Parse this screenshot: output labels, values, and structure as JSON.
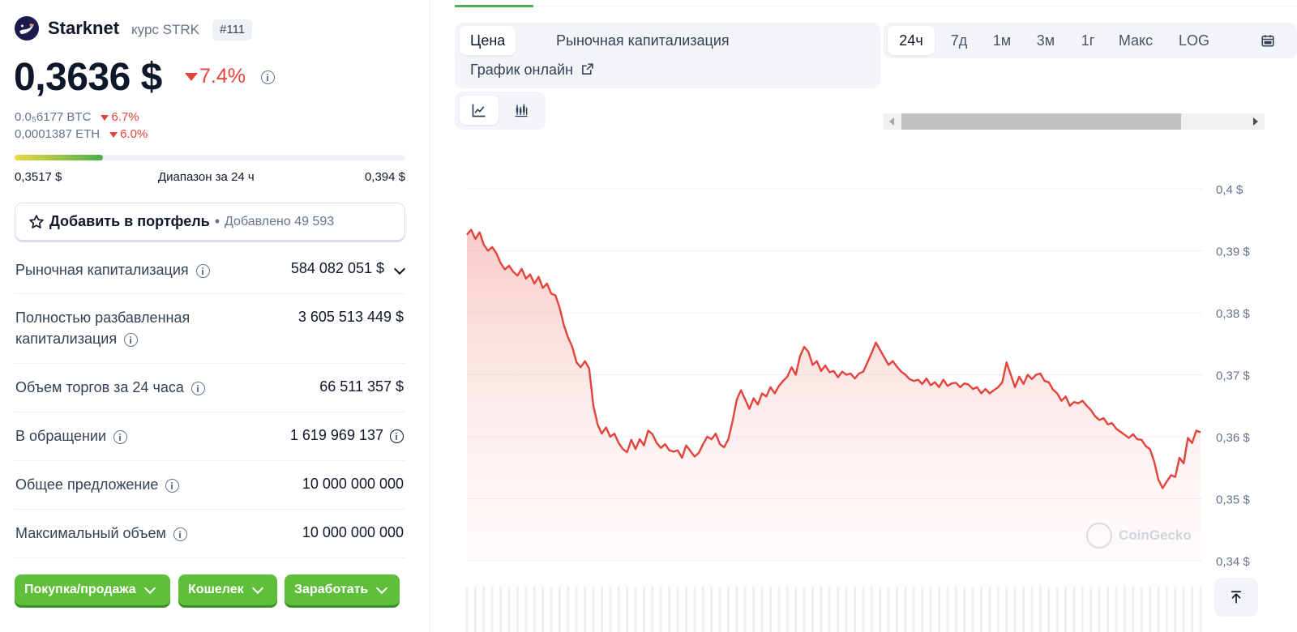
{
  "coin": {
    "name": "Starknet",
    "subtitle": "курс STRK",
    "rank": "#111",
    "price": "0,3636 $",
    "change": "7.4%",
    "btc_value": "0.0₅6177 BTC",
    "btc_change": "6.7%",
    "eth_value": "0,0001387 ETH",
    "eth_change": "6.0%"
  },
  "range": {
    "low": "0,3517 $",
    "label": "Диапазон за 24 ч",
    "high": "0,394 $",
    "position_fraction": 0.226
  },
  "portfolio": {
    "label": "Добавить в портфель",
    "separator": "•",
    "added": "Добавлено 49 593"
  },
  "stats": [
    {
      "label": "Рыночная капитализация",
      "value": "584 082 051 $"
    },
    {
      "label": "Полностью разбавленная капитализация",
      "value": "3 605 513 449 $"
    },
    {
      "label": "Объем торгов за 24 часа",
      "value": "66 511 357 $"
    },
    {
      "label": "В обращении",
      "value": "1 619 969 137"
    },
    {
      "label": "Общее предложение",
      "value": "10 000 000 000"
    },
    {
      "label": "Максимальный объем",
      "value": "10 000 000 000"
    }
  ],
  "actions": {
    "buy": "Покупка/продажа",
    "wallet": "Кошелек",
    "earn": "Заработать"
  },
  "tabs": {
    "price": "Цена",
    "market_cap": "Рыночная капитализация",
    "live": "График онлайн"
  },
  "periods": [
    "24ч",
    "7д",
    "1м",
    "3м",
    "1г",
    "Макс",
    "LOG"
  ],
  "watermark": "CoinGecko",
  "colors": {
    "accent_green": "#4caf50",
    "down_red": "#e4433b",
    "button_green": "#5fbf3a"
  },
  "chart_data": {
    "type": "area",
    "title": "",
    "xlabel": "",
    "ylabel": "",
    "ylim": [
      0.34,
      0.4
    ],
    "y_ticks": [
      "0,4 $",
      "0,39 $",
      "0,38 $",
      "0,37 $",
      "0,36 $",
      "0,35 $",
      "0,34 $"
    ],
    "y_tick_values": [
      0.4,
      0.39,
      0.38,
      0.37,
      0.36,
      0.35,
      0.34
    ],
    "series": [
      {
        "values": [
          0.3926,
          0.3934,
          0.3919,
          0.393,
          0.391,
          0.39,
          0.3906,
          0.3896,
          0.388,
          0.387,
          0.3876,
          0.3866,
          0.386,
          0.3871,
          0.3855,
          0.3862,
          0.3847,
          0.3858,
          0.384,
          0.3847,
          0.3831,
          0.3828,
          0.3808,
          0.378,
          0.376,
          0.3745,
          0.372,
          0.3712,
          0.3722,
          0.371,
          0.365,
          0.362,
          0.3605,
          0.3615,
          0.36,
          0.3605,
          0.359,
          0.358,
          0.3575,
          0.3595,
          0.358,
          0.3596,
          0.3586,
          0.361,
          0.3604,
          0.359,
          0.3582,
          0.3588,
          0.3578,
          0.3576,
          0.3578,
          0.3566,
          0.3586,
          0.3577,
          0.3568,
          0.3574,
          0.3588,
          0.36,
          0.3596,
          0.3605,
          0.3588,
          0.3583,
          0.3596,
          0.3625,
          0.366,
          0.3675,
          0.366,
          0.3645,
          0.3662,
          0.3652,
          0.367,
          0.3665,
          0.368,
          0.367,
          0.3682,
          0.369,
          0.3697,
          0.3712,
          0.37,
          0.373,
          0.3745,
          0.3737,
          0.3716,
          0.3722,
          0.3706,
          0.3715,
          0.3704,
          0.3706,
          0.3696,
          0.3705,
          0.37,
          0.3702,
          0.3694,
          0.3702,
          0.3705,
          0.372,
          0.3735,
          0.3752,
          0.374,
          0.3728,
          0.3716,
          0.3722,
          0.3713,
          0.3705,
          0.37,
          0.3693,
          0.369,
          0.3692,
          0.3685,
          0.3694,
          0.3683,
          0.3688,
          0.368,
          0.3692,
          0.3682,
          0.3686,
          0.3687,
          0.368,
          0.3686,
          0.3684,
          0.3677,
          0.368,
          0.367,
          0.3677,
          0.367,
          0.3675,
          0.368,
          0.3688,
          0.372,
          0.37,
          0.368,
          0.3697,
          0.3685,
          0.37,
          0.3693,
          0.37,
          0.3702,
          0.369,
          0.3688,
          0.3676,
          0.367,
          0.3658,
          0.3665,
          0.365,
          0.3656,
          0.3654,
          0.3658,
          0.365,
          0.3643,
          0.3633,
          0.3627,
          0.363,
          0.362,
          0.3622,
          0.3613,
          0.3608,
          0.3603,
          0.3598,
          0.3604,
          0.3596,
          0.3595,
          0.3585,
          0.358,
          0.356,
          0.3531,
          0.3517,
          0.3528,
          0.3538,
          0.3535,
          0.3566,
          0.3557,
          0.3598,
          0.359,
          0.361,
          0.3607
        ]
      }
    ],
    "grid": true,
    "y_axis_position": "right"
  }
}
